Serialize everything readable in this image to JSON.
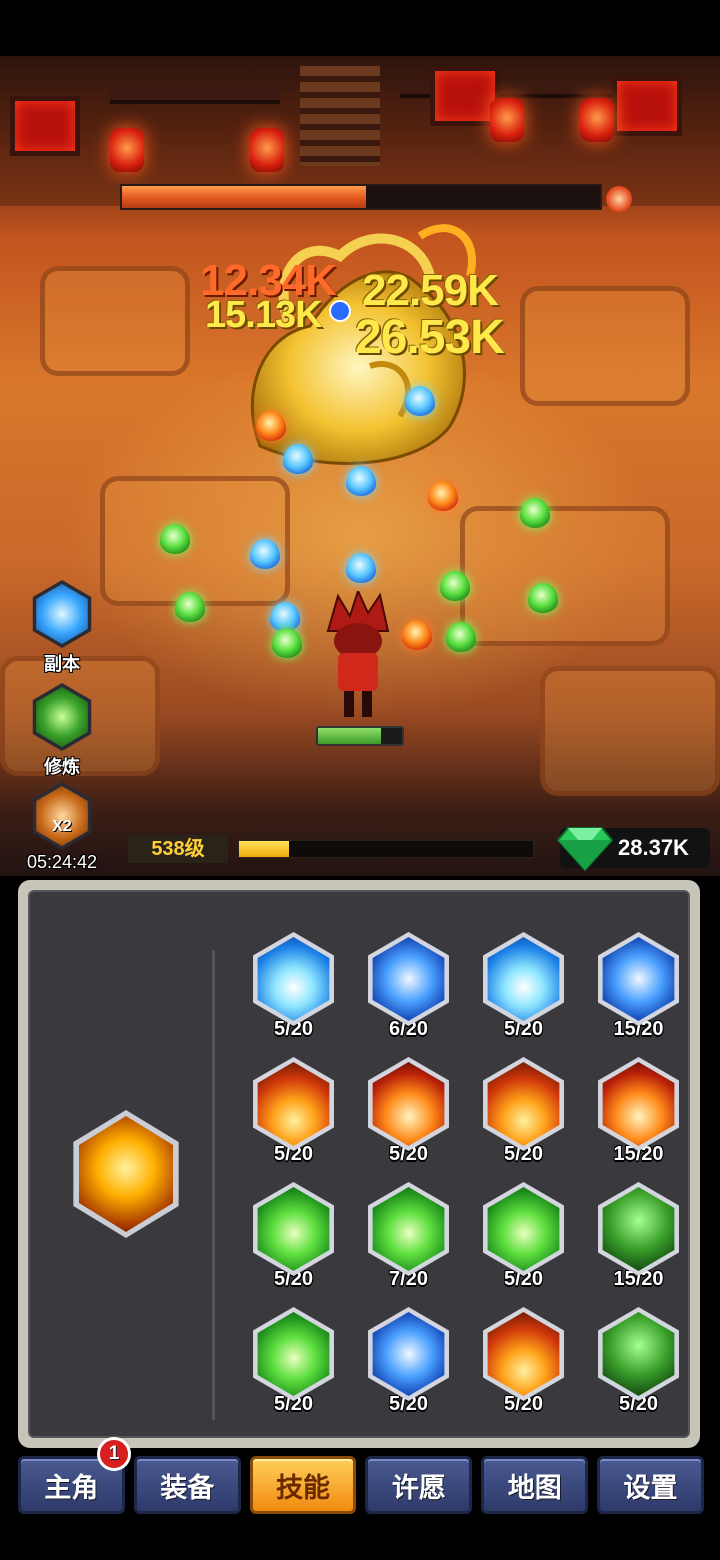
{
  "battle": {
    "damage_numbers": [
      "12.34K",
      "22.59K",
      "15.13K",
      "26.53K"
    ]
  },
  "side_buttons": [
    {
      "label": "副本"
    },
    {
      "label": "修炼"
    },
    {
      "label": "X2",
      "timer": "05:24:42"
    }
  ],
  "player": {
    "level": "538级",
    "xp_progress": 0.17,
    "gems": "28.37K"
  },
  "boss": {
    "hp_progress": 0.51
  },
  "hero": {
    "hp_progress": 0.75
  },
  "skills": [
    {
      "level": "5/20",
      "icon": "ice-burst-icon"
    },
    {
      "level": "6/20",
      "icon": "tornado-icon"
    },
    {
      "level": "5/20",
      "icon": "wave-icon"
    },
    {
      "level": "15/20",
      "icon": "ice-spikes-icon"
    },
    {
      "level": "5/20",
      "icon": "fire-wall-icon"
    },
    {
      "level": "5/20",
      "icon": "sun-orb-icon"
    },
    {
      "level": "5/20",
      "icon": "fire-blast-icon"
    },
    {
      "level": "15/20",
      "icon": "fire-ring-icon"
    },
    {
      "level": "5/20",
      "icon": "leaf-icon"
    },
    {
      "level": "7/20",
      "icon": "lightning-green-icon"
    },
    {
      "level": "5/20",
      "icon": "wind-ring-icon"
    },
    {
      "level": "15/20",
      "icon": "spirit-icon"
    },
    {
      "level": "5/20",
      "icon": "heal-heart-icon"
    },
    {
      "level": "5/20",
      "icon": "vortex-icon"
    },
    {
      "level": "5/20",
      "icon": "flame-burst-icon"
    },
    {
      "level": "5/20",
      "icon": "thorn-vine-icon"
    }
  ],
  "tabs": [
    {
      "label": "主角",
      "badge": "1"
    },
    {
      "label": "装备"
    },
    {
      "label": "技能",
      "active": true
    },
    {
      "label": "许愿"
    },
    {
      "label": "地图"
    },
    {
      "label": "设置"
    }
  ]
}
